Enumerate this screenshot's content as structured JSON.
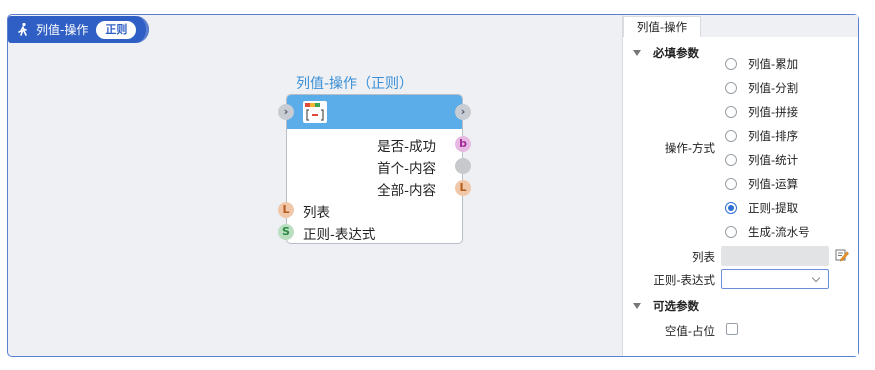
{
  "header": {
    "title": "列值-操作",
    "badge": "正则"
  },
  "node": {
    "title": "列值-操作（正则）",
    "outputs": [
      {
        "label": "是否-成功",
        "port": "b"
      },
      {
        "label": "首个-内容",
        "port": ""
      },
      {
        "label": "全部-内容",
        "port": "L"
      }
    ],
    "inputs": [
      {
        "label": "列表",
        "port": "L"
      },
      {
        "label": "正则-表达式",
        "port": "S"
      }
    ],
    "port_arrow": "›"
  },
  "panel": {
    "tab": "列值-操作",
    "required_section": "必填参数",
    "operation_label": "操作-方式",
    "options": [
      "列值-累加",
      "列值-分割",
      "列值-拼接",
      "列值-排序",
      "列值-统计",
      "列值-运算",
      "正则-提取",
      "生成-流水号"
    ],
    "selected_option": "正则-提取",
    "list_label": "列表",
    "list_value": "",
    "regex_label": "正则-表达式",
    "regex_value": "",
    "optional_section": "可选参数",
    "null_placeholder_label": "空值-占位",
    "null_placeholder_checked": false
  },
  "colors": {
    "accent": "#2f5fc4",
    "node_header": "#5aade8",
    "radio_selected": "#2f6fd6"
  }
}
